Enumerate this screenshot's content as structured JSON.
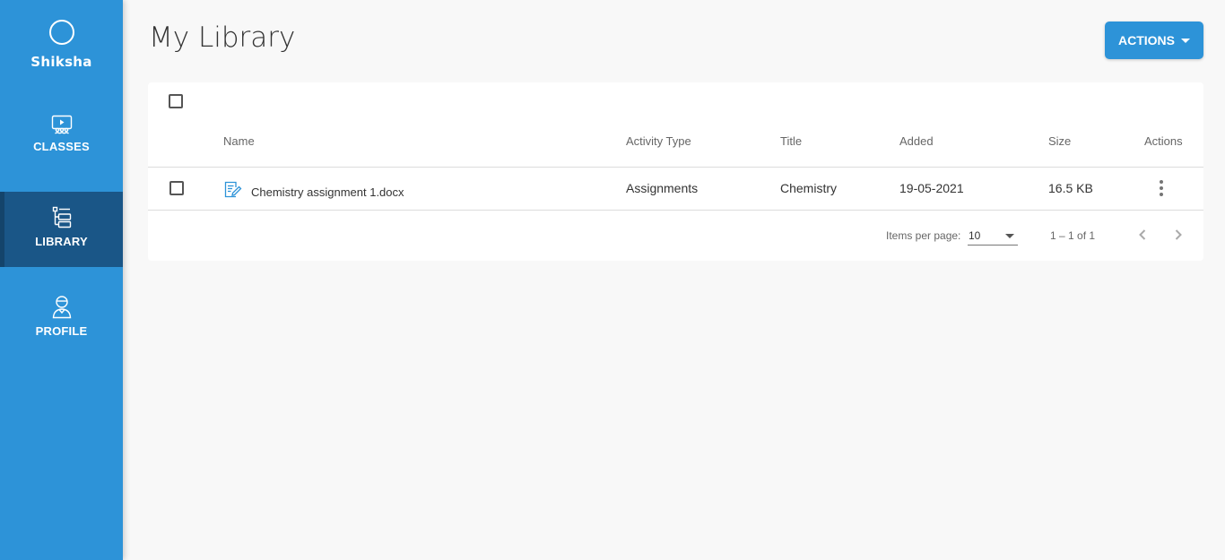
{
  "sidebar": {
    "brand": "Shiksha",
    "items": [
      {
        "label": "CLASSES",
        "icon": "classes-icon"
      },
      {
        "label": "LIBRARY",
        "icon": "library-icon",
        "active": true
      },
      {
        "label": "PROFILE",
        "icon": "profile-icon"
      }
    ]
  },
  "header": {
    "title": "My Library",
    "actions_label": "ACTIONS"
  },
  "table": {
    "columns": [
      "Name",
      "Activity Type",
      "Title",
      "Added",
      "Size",
      "Actions"
    ],
    "rows": [
      {
        "name": "Chemistry assignment 1.docx",
        "activity_type": "Assignments",
        "title": "Chemistry",
        "added": "19-05-2021",
        "size": "16.5 KB",
        "icon": "document-edit-icon"
      }
    ]
  },
  "pagination": {
    "items_per_page_label": "Items per page:",
    "items_per_page": "10",
    "range": "1 – 1 of 1"
  },
  "colors": {
    "sidebar": "#2d93d8",
    "sidebar_active": "#1a5687",
    "accent": "#2d93d8"
  }
}
